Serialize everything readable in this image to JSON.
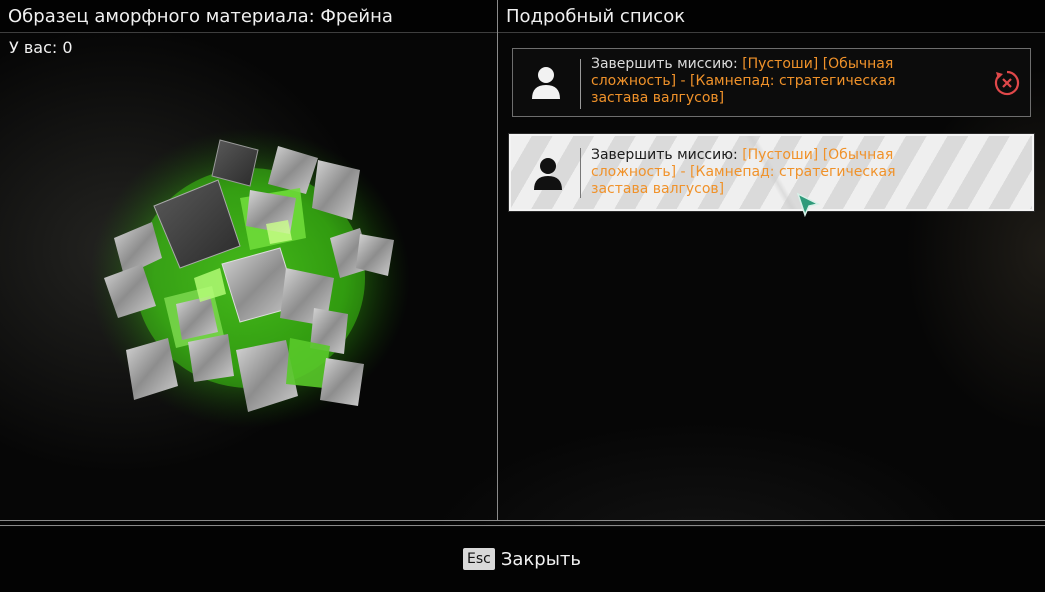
{
  "left_panel": {
    "title": "Образец аморфного материала: Фрейна",
    "owned_label": "У вас: 0",
    "item_icon": "amorphous-material-cube-cluster"
  },
  "right_panel": {
    "title": "Подробный список",
    "entries": [
      {
        "prefix": "Завершить миссию: ",
        "highlight": "[Пустоши] [Обычная сложность] - [Камнепад: стратегическая застава валгусов]",
        "icon": "person-icon",
        "action_icon": "cancel-icon",
        "selected": false
      },
      {
        "prefix": "Завершить миссию: ",
        "highlight": "[Пустоши] [Обычная сложность] - [Камнепад: стратегическая застава валгусов]",
        "icon": "person-icon",
        "selected": true
      }
    ]
  },
  "footer": {
    "key_label": "Esc",
    "close_label": "Закрыть"
  },
  "colors": {
    "highlight": "#f0922a",
    "material_glow": "#5cff2a",
    "cancel": "#e0484a"
  }
}
